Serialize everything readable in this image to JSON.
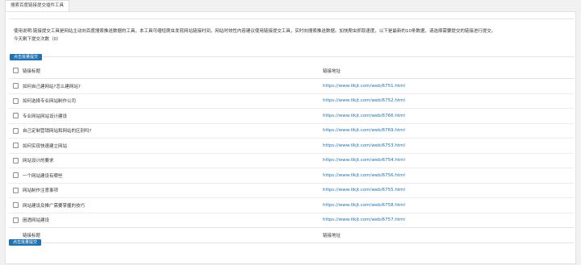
{
  "tab": {
    "label": "搜索百度链接提交插件工具"
  },
  "notice": {
    "line1": "使用说明:链接提交工具是网站主动向百度搜索推送数据的工具，本工具可缩短爬虫发现网站链接时间，网站时效性内容建议使用链接提交工具，实时向搜索推送数据。加快爬虫抓取速度，以下是最新的10条数据，请选择需要提交的链接进行提交。",
    "line2": "今天剩下提交次数（0）"
  },
  "buttons": {
    "submit_top": "点击批量提交",
    "submit_bottom": "点击批量提交"
  },
  "table": {
    "col_title": "链接标题",
    "col_url": "链接地址",
    "rows": [
      {
        "title": "如何自己建网站?怎么建网站?",
        "url": "https://www.tlkjt.com/web/6751.html"
      },
      {
        "title": "如何选择专业网站制作公司",
        "url": "https://www.tlkjt.com/web/6752.html"
      },
      {
        "title": "专业网站网站设计建设",
        "url": "https://www.tlkjt.com/web/6766.html"
      },
      {
        "title": "自己定制营销网站和网站的区别吗?",
        "url": "https://www.tlkjt.com/web/6769.html"
      },
      {
        "title": "如何实现快速建立网站",
        "url": "https://www.tlkjt.com/web/6753.html"
      },
      {
        "title": "网站设计的要求",
        "url": "https://www.tlkjt.com/web/6754.html"
      },
      {
        "title": "一个网站建设有哪些",
        "url": "https://www.tlkjt.com/web/6756.html"
      },
      {
        "title": "网站制作注意事项",
        "url": "https://www.tlkjt.com/web/6755.html"
      },
      {
        "title": "网站建设及推广需要掌握的技巧",
        "url": "https://www.tlkjt.com/web/6758.html"
      },
      {
        "title": "困透网站建设",
        "url": "https://www.tlkjt.com/web/6757.html"
      }
    ]
  }
}
